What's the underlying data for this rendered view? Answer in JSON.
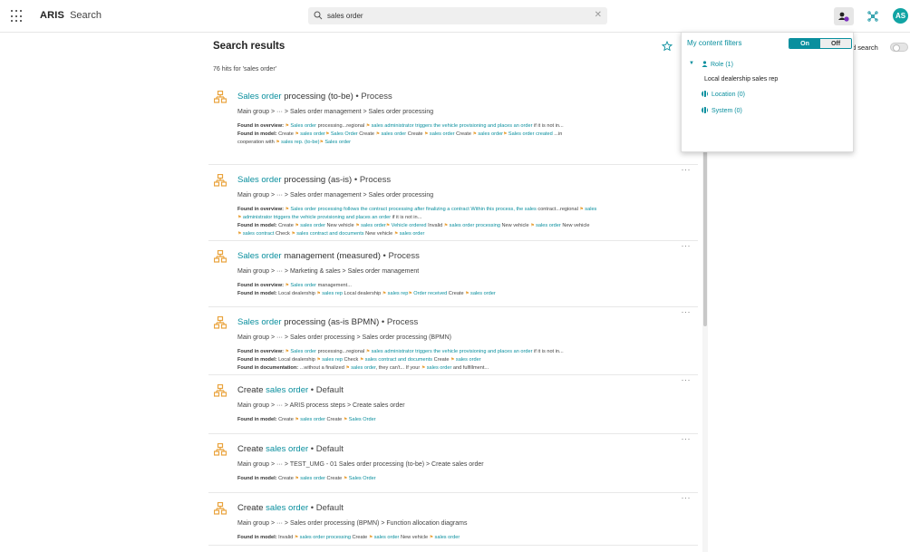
{
  "app": {
    "brand": "ARIS",
    "section": "Search",
    "avatar_initials": "AS",
    "accent": "#0a8f9e"
  },
  "search": {
    "query": "sales order"
  },
  "results_header": {
    "title": "Search results",
    "hits": "76 hits for 'sales order'",
    "advanced_search_label": "d search"
  },
  "filters_panel": {
    "title": "My content filters",
    "on_label": "On",
    "off_label": "Off",
    "role": "Role (1)",
    "role_value": "Local dealership sales rep",
    "location": "Location (0)",
    "system": "System (0)"
  },
  "results": [
    {
      "title": [
        {
          "t": "Sales order",
          "hl": true
        },
        {
          "t": " processing (to-be)",
          "hl": false
        }
      ],
      "type": "Process",
      "crumb": "Main group > ··· > Sales order management > Sales order processing",
      "found": [
        {
          "label": "Found in overview:",
          "parts": [
            {
              "t": "Sales order",
              "hl": true
            },
            {
              "t": " processing...regional ",
              "hl": false
            },
            {
              "t": "sales administrator triggers the vehicle provisioning and places an order",
              "hl": true
            },
            {
              "t": " if it is not in...",
              "hl": false
            }
          ]
        },
        {
          "label": "Found in model:",
          "parts": [
            {
              "t": "Create ",
              "hl": false
            },
            {
              "t": "sales order",
              "hl": true
            },
            {
              "t": "  Sales Order",
              "hl": true
            },
            {
              "t": "  Create ",
              "hl": false
            },
            {
              "t": "sales order",
              "hl": true
            },
            {
              "t": "  Create ",
              "hl": false
            },
            {
              "t": "sales order",
              "hl": true
            },
            {
              "t": "  Create ",
              "hl": false
            },
            {
              "t": "sales order",
              "hl": true
            },
            {
              "t": "  Sales order created",
              "hl": true
            },
            {
              "t": "  ...in",
              "hl": false
            }
          ]
        },
        {
          "label": "",
          "parts": [
            {
              "t": "cooperation with ",
              "hl": false
            },
            {
              "t": "sales rep. (to-be)",
              "hl": true
            },
            {
              "t": "  Sales order",
              "hl": true
            }
          ]
        }
      ]
    },
    {
      "title": [
        {
          "t": "Sales order",
          "hl": true
        },
        {
          "t": " processing (as-is)",
          "hl": false
        }
      ],
      "type": "Process",
      "crumb": "Main group > ··· > Sales order management > Sales order processing",
      "found": [
        {
          "label": "Found in overview:",
          "parts": [
            {
              "t": "Sales order processing follows the contract processing after finalizing a contract Within this process, the sales",
              "hl": true
            },
            {
              "t": " contract...regional ",
              "hl": false
            },
            {
              "t": "sales",
              "hl": true
            }
          ]
        },
        {
          "label": "",
          "parts": [
            {
              "t": "administrator triggers the vehicle provisioning and places an order",
              "hl": true
            },
            {
              "t": " if it is not in...",
              "hl": false
            }
          ]
        },
        {
          "label": "Found in model:",
          "parts": [
            {
              "t": "Create ",
              "hl": false
            },
            {
              "t": "sales order",
              "hl": true
            },
            {
              "t": "  New vehicle ",
              "hl": false
            },
            {
              "t": "sales order",
              "hl": true
            },
            {
              "t": "  Vehicle ordered",
              "hl": true
            },
            {
              "t": "  Invalid ",
              "hl": false
            },
            {
              "t": "sales order processing",
              "hl": true
            },
            {
              "t": "  New vehicle ",
              "hl": false
            },
            {
              "t": "sales order",
              "hl": true
            },
            {
              "t": "  New vehicle",
              "hl": false
            }
          ]
        },
        {
          "label": "",
          "parts": [
            {
              "t": "sales contract",
              "hl": true
            },
            {
              "t": "  Check ",
              "hl": false
            },
            {
              "t": "sales contract and documents",
              "hl": true
            },
            {
              "t": "  New vehicle ",
              "hl": false
            },
            {
              "t": "sales order",
              "hl": true
            }
          ]
        }
      ]
    },
    {
      "title": [
        {
          "t": "Sales order",
          "hl": true
        },
        {
          "t": " management (measured)",
          "hl": false
        }
      ],
      "type": "Process",
      "crumb": "Main group > ··· > Marketing & sales > Sales order management",
      "found": [
        {
          "label": "Found in overview:",
          "parts": [
            {
              "t": "Sales order",
              "hl": true
            },
            {
              "t": " management...",
              "hl": false
            }
          ]
        },
        {
          "label": "Found in model:",
          "parts": [
            {
              "t": "Local dealership ",
              "hl": false
            },
            {
              "t": "sales rep",
              "hl": true
            },
            {
              "t": "  Local dealership ",
              "hl": false
            },
            {
              "t": "sales rep",
              "hl": true
            },
            {
              "t": "  Order received",
              "hl": true
            },
            {
              "t": "  Create ",
              "hl": false
            },
            {
              "t": "sales order",
              "hl": true
            }
          ]
        }
      ]
    },
    {
      "title": [
        {
          "t": "Sales order",
          "hl": true
        },
        {
          "t": " processing (as-is BPMN)",
          "hl": false
        }
      ],
      "type": "Process",
      "crumb": "Main group > ··· > Sales order processing > Sales order processing (BPMN)",
      "found": [
        {
          "label": "Found in overview:",
          "parts": [
            {
              "t": "Sales order",
              "hl": true
            },
            {
              "t": " processing...regional ",
              "hl": false
            },
            {
              "t": "sales administrator triggers the vehicle provisioning and places an order",
              "hl": true
            },
            {
              "t": " if it is not in...",
              "hl": false
            }
          ]
        },
        {
          "label": "Found in model:",
          "parts": [
            {
              "t": "Local dealership ",
              "hl": false
            },
            {
              "t": "sales rep",
              "hl": true
            },
            {
              "t": "  Check ",
              "hl": false
            },
            {
              "t": "sales contract and documents",
              "hl": true
            },
            {
              "t": "  Create ",
              "hl": false
            },
            {
              "t": "sales order",
              "hl": true
            }
          ]
        },
        {
          "label": "Found in documentation:",
          "parts": [
            {
              "t": "...without a finalized ",
              "hl": false
            },
            {
              "t": "sales order",
              "hl": true
            },
            {
              "t": ", they can't... If your ",
              "hl": false
            },
            {
              "t": "sales order",
              "hl": true
            },
            {
              "t": " and fulfillment...",
              "hl": false
            }
          ]
        }
      ]
    },
    {
      "title": [
        {
          "t": "Create ",
          "hl": false
        },
        {
          "t": "sales order",
          "hl": true
        }
      ],
      "type": "Default",
      "crumb": "Main group > ··· > ARIS process steps > Create sales order",
      "found": [
        {
          "label": "Found in model:",
          "parts": [
            {
              "t": "Create ",
              "hl": false
            },
            {
              "t": "sales order",
              "hl": true
            },
            {
              "t": "  Create ",
              "hl": false
            },
            {
              "t": "Sales Order",
              "hl": true
            }
          ]
        }
      ]
    },
    {
      "title": [
        {
          "t": "Create ",
          "hl": false
        },
        {
          "t": "sales order",
          "hl": true
        }
      ],
      "type": "Default",
      "crumb": "Main group > ··· > TEST_UMG - 01 Sales order processing (to-be) > Create sales order",
      "found": [
        {
          "label": "Found in model:",
          "parts": [
            {
              "t": "Create ",
              "hl": false
            },
            {
              "t": "sales order",
              "hl": true
            },
            {
              "t": "  Create ",
              "hl": false
            },
            {
              "t": "Sales Order",
              "hl": true
            }
          ]
        }
      ]
    },
    {
      "title": [
        {
          "t": "Create ",
          "hl": false
        },
        {
          "t": "sales order",
          "hl": true
        }
      ],
      "type": "Default",
      "crumb": "Main group > ··· > Sales order processing (BPMN) > Function allocation diagrams",
      "found": [
        {
          "label": "Found in model:",
          "parts": [
            {
              "t": "Invalid ",
              "hl": false
            },
            {
              "t": "sales order processing",
              "hl": true
            },
            {
              "t": "  Create ",
              "hl": false
            },
            {
              "t": "sales order",
              "hl": true
            },
            {
              "t": "  New vehicle ",
              "hl": false
            },
            {
              "t": "sales order",
              "hl": true
            }
          ]
        }
      ]
    }
  ]
}
